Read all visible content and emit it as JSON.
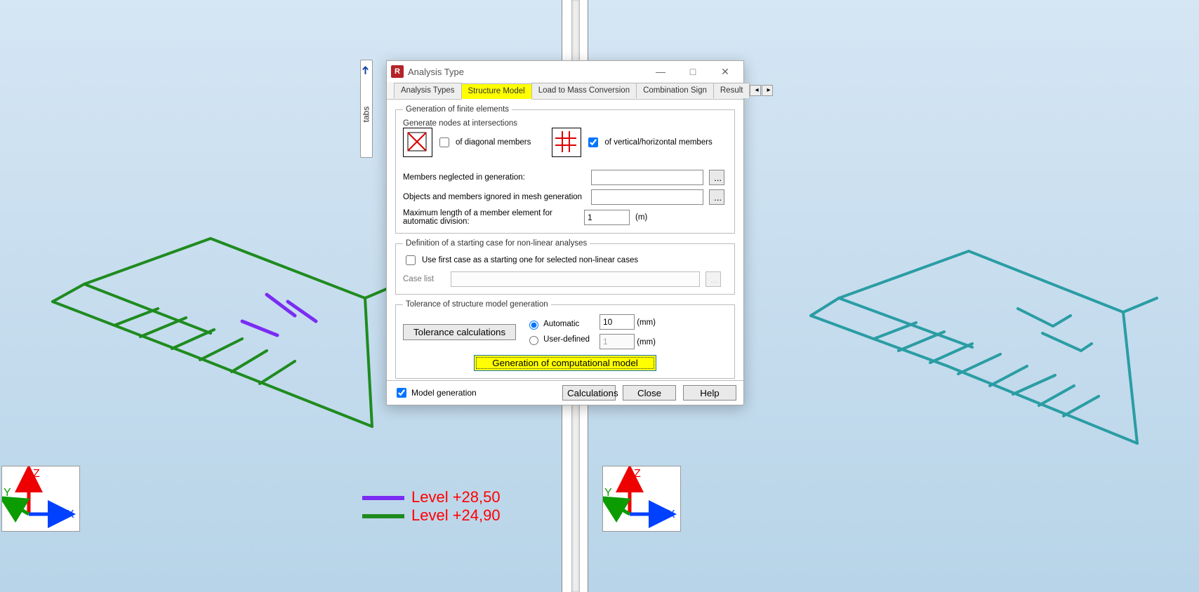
{
  "dialog": {
    "title": "Analysis Type",
    "tabs": [
      "Analysis Types",
      "Structure Model",
      "Load to Mass Conversion",
      "Combination Sign",
      "Result"
    ],
    "active_tab": 1,
    "fs_generation": "Generation of finite elements",
    "fs_nodes": "Generate nodes at intersections",
    "cb_diag": "of diagonal members",
    "cb_vh": "of vertical/horizontal members",
    "cb_vh_checked": true,
    "neglected_label": "Members neglected in generation:",
    "neglected_value": "",
    "ignored_label": "Objects and members ignored in mesh generation",
    "ignored_value": "",
    "maxlen_label": "Maximum length of a member element for automatic division:",
    "maxlen_value": "1",
    "maxlen_unit": "(m)",
    "fs_starting": "Definition of a starting case for non-linear analyses",
    "cb_usefirst": "Use first case as a starting one for selected non-linear cases",
    "caselist_label": "Case list",
    "caselist_value": "",
    "fs_tolerance": "Tolerance of structure model generation",
    "btn_tolerance": "Tolerance calculations",
    "radio_auto": "Automatic",
    "radio_user": "User-defined",
    "tol_auto_val": "10",
    "tol_user_val": "1",
    "tol_unit": "(mm)",
    "btn_generate": "Generation of computational model",
    "cb_modelgen": "Model generation",
    "cb_modelgen_checked": true,
    "footer": {
      "calc": "Calculations",
      "close": "Close",
      "help": "Help"
    }
  },
  "tabs_handle": "tabs",
  "legend": [
    {
      "color": "#7a2cf3",
      "label": "Level +28,50"
    },
    {
      "color": "#1f8b1f",
      "label": "Level +24,90"
    }
  ],
  "axes": {
    "x": "X",
    "y": "Y",
    "z": "Z"
  }
}
